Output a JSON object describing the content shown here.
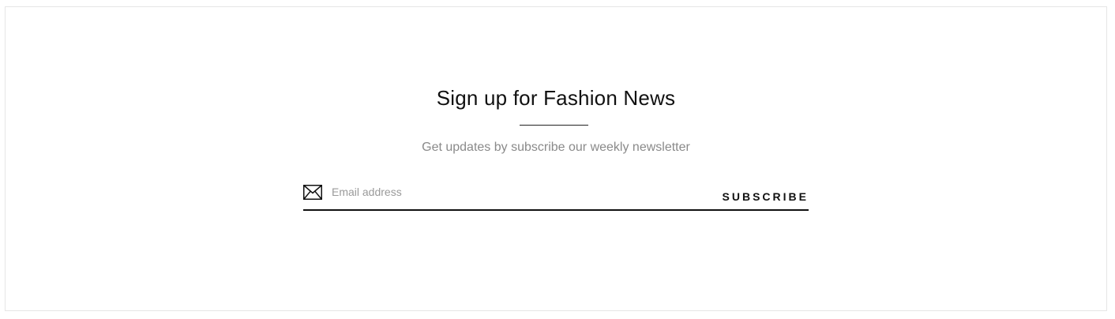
{
  "newsletter": {
    "title": "Sign up for Fashion News",
    "subtitle": "Get updates by subscribe our weekly newsletter",
    "email_placeholder": "Email address",
    "email_value": "",
    "subscribe_label": "SUBSCRIBE",
    "icon": "envelope-icon"
  }
}
